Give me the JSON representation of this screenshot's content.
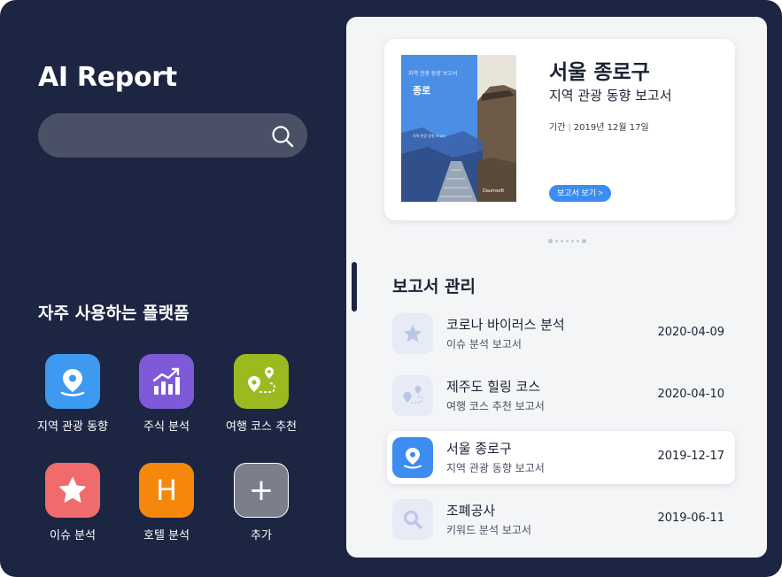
{
  "app": {
    "title": "AI Report"
  },
  "search": {
    "placeholder": ""
  },
  "platforms": {
    "title": "자주 사용하는 플랫폼",
    "items": [
      {
        "label": "지역 관광 동향",
        "icon": "map-pin-icon",
        "color": "#3d9af0"
      },
      {
        "label": "주식 분석",
        "icon": "chart-up-icon",
        "color": "#7e5ad8"
      },
      {
        "label": "여행 코스 추천",
        "icon": "route-icon",
        "color": "#9bba20"
      },
      {
        "label": "이슈 분석",
        "icon": "star-icon",
        "color": "#f06b6b"
      },
      {
        "label": "호텔 분석",
        "icon": "hotel-h-icon",
        "color": "#f5880c",
        "glyph": "H"
      },
      {
        "label": "추가",
        "icon": "plus-icon",
        "color": "#7b7f8c",
        "glyph": "+"
      }
    ]
  },
  "featured": {
    "title": "서울 종로구",
    "subtitle": "지역 관광 동향 보고서",
    "period_label": "기간",
    "period_value": "2019년 12월 17일",
    "button_label": "보고서 보기  >",
    "cover": {
      "top_text": "지역 관광 동향 보고서",
      "region": "종로",
      "sub_text": "지역 관광 동향 보고서",
      "brand": "Daumsoft"
    }
  },
  "reports": {
    "title": "보고서 관리",
    "items": [
      {
        "name": "코로나 바이러스 분석",
        "type": "이슈 분석 보고서",
        "date": "2020-04-09",
        "icon": "star-icon",
        "active": false
      },
      {
        "name": "제주도 힐링 코스",
        "type": "여행 코스 추천 보고서",
        "date": "2020-04-10",
        "icon": "route-icon",
        "active": false
      },
      {
        "name": "서울 종로구",
        "type": "지역 관광 동향 보고서",
        "date": "2019-12-17",
        "icon": "map-pin-icon",
        "active": true
      },
      {
        "name": "조폐공사",
        "type": "키워드 분석 보고서",
        "date": "2019-06-11",
        "icon": "search-icon",
        "active": false
      }
    ]
  },
  "colors": {
    "background": "#1c2541",
    "panel": "#f4f5f7",
    "accent": "#3d8cf0",
    "icon_muted": "#b9c6e8"
  }
}
